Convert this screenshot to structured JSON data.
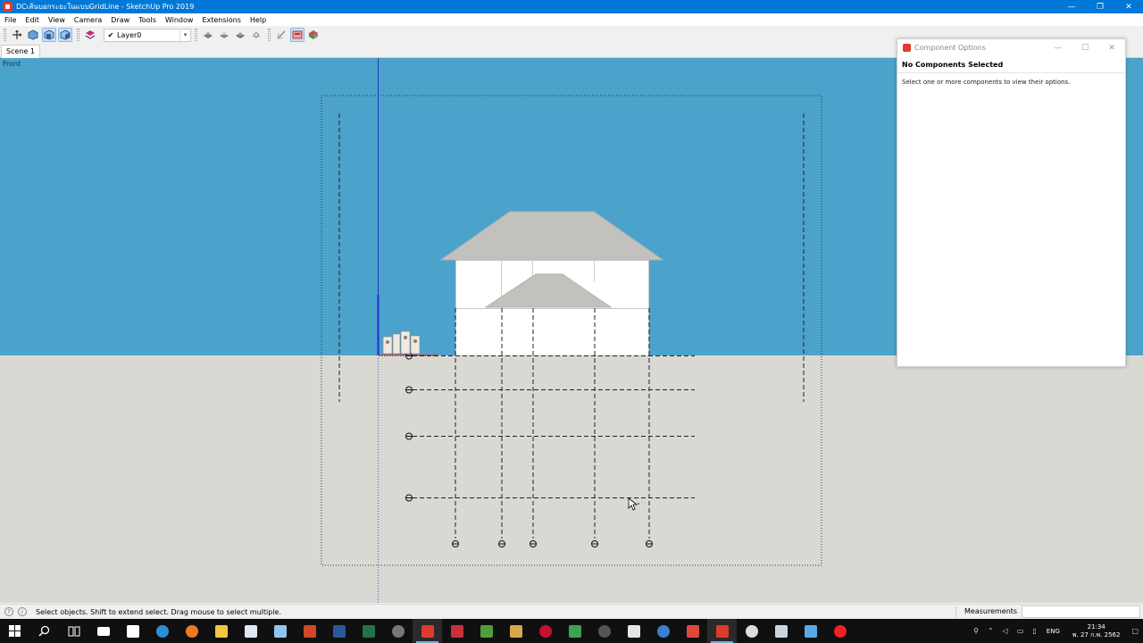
{
  "window": {
    "title": "DCเส้นบอกระยะในแบบGridLine - SketchUp Pro 2019",
    "minimize": "—",
    "maximize": "❐",
    "close": "✕"
  },
  "menu": [
    "File",
    "Edit",
    "View",
    "Camera",
    "Draw",
    "Tools",
    "Window",
    "Extensions",
    "Help"
  ],
  "toolbar": {
    "layer_check": "✔",
    "layer_name": "Layer0",
    "layer_arrow": "▾"
  },
  "scene": {
    "tab_label": "Scene 1"
  },
  "viewport": {
    "view_name": "Front",
    "sky_color": "#4ba3cb",
    "ground_color": "#d9d8d3"
  },
  "panel": {
    "title": "Component Options",
    "heading": "No Components Selected",
    "message": "Select one or more components to view their options.",
    "minimize": "—",
    "maximize": "☐",
    "close": "✕"
  },
  "status": {
    "message": "Select objects. Shift to extend select. Drag mouse to select multiple.",
    "measurements_label": "Measurements",
    "measurements_value": ""
  },
  "taskbar": {
    "tray_lang": "ENG",
    "time": "21:34",
    "date": "พ. 27 ก.พ. 2562"
  }
}
